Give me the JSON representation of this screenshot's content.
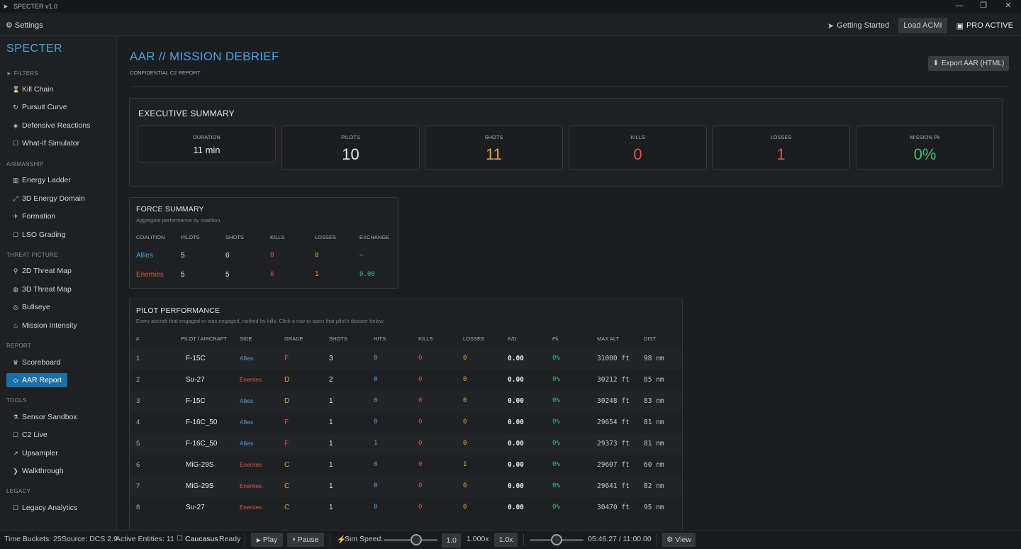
{
  "app": {
    "title": "SPECTER v1.0",
    "brand": "SPECTER"
  },
  "window_controls": {
    "minimize": "—",
    "maximize": "❐",
    "close": "✕"
  },
  "menubar": {
    "settings_icon": "⚙",
    "settings": "Settings",
    "getting_started_icon": "➤",
    "getting_started": "Getting Started",
    "load_acmi": "Load ACMI",
    "pro_icon": "▣",
    "pro": "PRO ACTIVE"
  },
  "sidebar": {
    "filters_label": "► FILTERS",
    "filters": [
      {
        "icon": "⌛",
        "label": "Kill Chain"
      },
      {
        "icon": "↻",
        "label": "Pursuit Curve"
      },
      {
        "icon": "◈",
        "label": "Defensive Reactions"
      },
      {
        "icon": "☐",
        "label": "What-If Simulator"
      }
    ],
    "airmanship_label": "AIRMANSHIP",
    "airmanship": [
      {
        "icon": "▥",
        "label": "Energy Ladder"
      },
      {
        "icon": "⤢",
        "label": "3D Energy Domain"
      },
      {
        "icon": "✈",
        "label": "Formation"
      },
      {
        "icon": "☐",
        "label": "LSO Grading"
      }
    ],
    "threat_label": "THREAT PICTURE",
    "threat": [
      {
        "icon": "⚲",
        "label": "2D Threat Map"
      },
      {
        "icon": "◍",
        "label": "3D Threat Map"
      },
      {
        "icon": "◎",
        "label": "Bullseye"
      },
      {
        "icon": "♨",
        "label": "Mission Intensity"
      }
    ],
    "report_label": "REPORT",
    "report": [
      {
        "icon": "♛",
        "label": "Scoreboard"
      },
      {
        "icon": "◇",
        "label": "AAR Report"
      }
    ],
    "tools_label": "TOOLS",
    "tools": [
      {
        "icon": "⚗",
        "label": "Sensor Sandbox"
      },
      {
        "icon": "☐",
        "label": "C2 Live"
      },
      {
        "icon": "↗",
        "label": "Upsampler"
      },
      {
        "icon": "❯",
        "label": "Walkthrough"
      }
    ],
    "legacy_label": "LEGACY",
    "legacy": [
      {
        "icon": "☐",
        "label": "Legacy Analytics"
      }
    ]
  },
  "header": {
    "title": "AAR // MISSION DEBRIEF",
    "subtitle": "CONFIDENTIAL C2 REPORT",
    "export_icon": "⬇",
    "export": "Export AAR (HTML)"
  },
  "executive": {
    "title": "EXECUTIVE SUMMARY",
    "kpis": [
      {
        "label": "DURATION",
        "value": "11 min",
        "color": "#e6e8eb"
      },
      {
        "label": "PILOTS",
        "value": "10",
        "color": "#e6e8eb"
      },
      {
        "label": "SHOTS",
        "value": "11",
        "color": "#e3a63a"
      },
      {
        "label": "KILLS",
        "value": "0",
        "color": "#e0554a"
      },
      {
        "label": "LOSSES",
        "value": "1",
        "color": "#e0554a"
      },
      {
        "label": "MISSION Pk",
        "value": "0%",
        "color": "#3dbb78"
      }
    ]
  },
  "force": {
    "title": "FORCE SUMMARY",
    "subtitle": "Aggregate performance by coalition.",
    "headers": [
      "COALITION",
      "PILOTS",
      "SHOTS",
      "KILLS",
      "LOSSES",
      "EXCHANGE"
    ],
    "rows": [
      {
        "coalition": "Allies",
        "pilots": "5",
        "shots": "6",
        "kills": "0",
        "losses": "0",
        "exchange": "—"
      },
      {
        "coalition": "Enemies",
        "pilots": "5",
        "shots": "5",
        "kills": "0",
        "losses": "1",
        "exchange": "0.00"
      }
    ]
  },
  "pilots": {
    "title": "PILOT PERFORMANCE",
    "subtitle": "Every aircraft that engaged or was engaged, ranked by kills. Click a row to open that pilot's dossier below.",
    "headers": [
      "#",
      "PILOT / AIRCRAFT",
      "SIDE",
      "GRADE",
      "SHOTS",
      "HITS",
      "KILLS",
      "LOSSES",
      "K/D",
      "Pk",
      "MAX ALT",
      "DIST"
    ],
    "rows": [
      {
        "n": "1",
        "aircraft": "F-15C",
        "side": "Allies",
        "grade": "F",
        "shots": "3",
        "hits": "0",
        "kills": "0",
        "losses": "0",
        "kd": "0.00",
        "pk": "0%",
        "alt": "31000 ft",
        "dist": "98 nm"
      },
      {
        "n": "2",
        "aircraft": "Su-27",
        "side": "Enemies",
        "grade": "D",
        "shots": "2",
        "hits": "0",
        "kills": "0",
        "losses": "0",
        "kd": "0.00",
        "pk": "0%",
        "alt": "30212 ft",
        "dist": "85 nm"
      },
      {
        "n": "3",
        "aircraft": "F-15C",
        "side": "Allies",
        "grade": "D",
        "shots": "1",
        "hits": "0",
        "kills": "0",
        "losses": "0",
        "kd": "0.00",
        "pk": "0%",
        "alt": "30248 ft",
        "dist": "83 nm"
      },
      {
        "n": "4",
        "aircraft": "F-16C_50",
        "side": "Allies",
        "grade": "F",
        "shots": "1",
        "hits": "0",
        "kills": "0",
        "losses": "0",
        "kd": "0.00",
        "pk": "0%",
        "alt": "29654 ft",
        "dist": "81 nm"
      },
      {
        "n": "5",
        "aircraft": "F-16C_50",
        "side": "Allies",
        "grade": "F",
        "shots": "1",
        "hits": "1",
        "kills": "0",
        "losses": "0",
        "kd": "0.00",
        "pk": "0%",
        "alt": "29373 ft",
        "dist": "81 nm"
      },
      {
        "n": "6",
        "aircraft": "MiG-29S",
        "side": "Enemies",
        "grade": "C",
        "shots": "1",
        "hits": "0",
        "kills": "0",
        "losses": "1",
        "kd": "0.00",
        "pk": "0%",
        "alt": "29607 ft",
        "dist": "60 nm"
      },
      {
        "n": "7",
        "aircraft": "MiG-29S",
        "side": "Enemies",
        "grade": "C",
        "shots": "1",
        "hits": "0",
        "kills": "0",
        "losses": "0",
        "kd": "0.00",
        "pk": "0%",
        "alt": "29641 ft",
        "dist": "82 nm"
      },
      {
        "n": "8",
        "aircraft": "Su-27",
        "side": "Enemies",
        "grade": "C",
        "shots": "1",
        "hits": "0",
        "kills": "0",
        "losses": "0",
        "kd": "0.00",
        "pk": "0%",
        "alt": "30470 ft",
        "dist": "95 nm"
      }
    ]
  },
  "statusbar": {
    "time_buckets": "Time Buckets: 25",
    "source": "Source: DCS 2.9",
    "active": "Active Entities: 11",
    "map_checkbox": "☐",
    "map": "Caucasus",
    "ready": "Ready",
    "play_icon": "▶",
    "play": "Play",
    "pause_icon": "⏸",
    "pause": "Pause",
    "speed_icon": "⚡",
    "sim_speed": "Sim Speed:",
    "sim_speed_fraction": 0.6,
    "speed_box": "1.0",
    "speed_readout": "1.000x",
    "speed_reset": "1.0x",
    "timeline_fraction": 0.5,
    "time": "05:46.27 / 11:00.00",
    "view_icon": "⚙",
    "view": "View"
  },
  "colors": {
    "accent": "#4aa3e0",
    "allies": "#4aa3e0",
    "enemies": "#e0554a",
    "orange": "#e3a63a",
    "green": "#3dbb78",
    "active_nav": "#1b6fa5"
  }
}
